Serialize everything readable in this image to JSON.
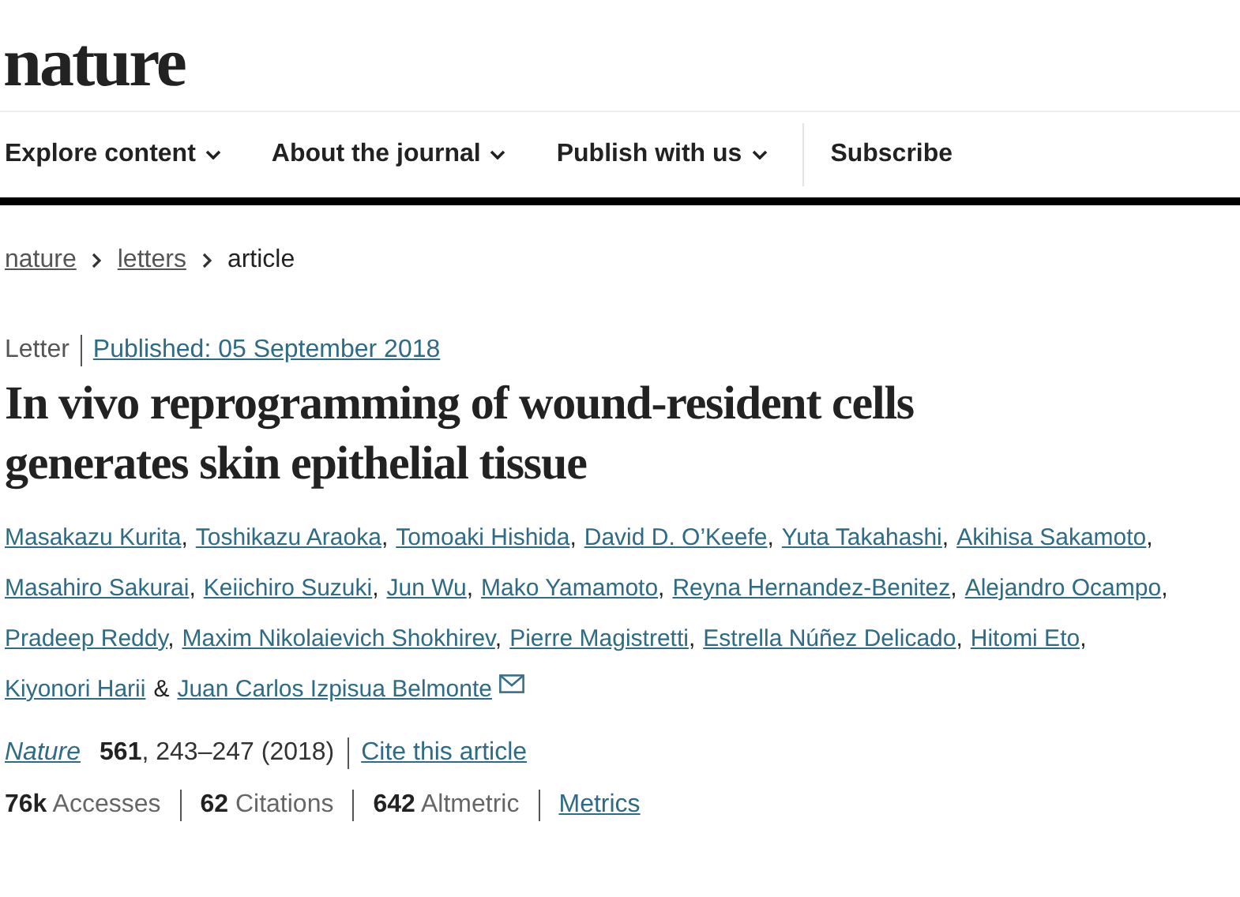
{
  "logo": "nature",
  "nav": [
    {
      "label": "Explore content",
      "kind": "menu"
    },
    {
      "label": "About the journal",
      "kind": "menu"
    },
    {
      "label": "Publish with us",
      "kind": "menu"
    },
    {
      "label": "Subscribe",
      "kind": "link"
    }
  ],
  "breadcrumbs": [
    {
      "label": "nature",
      "kind": "link"
    },
    {
      "label": "letters",
      "kind": "link"
    },
    {
      "label": "article",
      "kind": "current"
    }
  ],
  "article_type": "Letter",
  "published": "Published: 05 September 2018",
  "title": "In vivo reprogramming of wound-resident cells generates skin epithelial tissue",
  "authors": [
    {
      "name": "Masakazu Kurita",
      "separator": ",",
      "corresponding": false
    },
    {
      "name": "Toshikazu Araoka",
      "separator": ",",
      "corresponding": false
    },
    {
      "name": "Tomoaki Hishida",
      "separator": ",",
      "corresponding": false
    },
    {
      "name": "David D. O’Keefe",
      "separator": ",",
      "corresponding": false
    },
    {
      "name": "Yuta Takahashi",
      "separator": ",",
      "corresponding": false
    },
    {
      "name": "Akihisa Sakamoto",
      "separator": ",",
      "corresponding": false
    },
    {
      "name": "Masahiro Sakurai",
      "separator": ",",
      "corresponding": false
    },
    {
      "name": "Keiichiro Suzuki",
      "separator": ",",
      "corresponding": false
    },
    {
      "name": "Jun Wu",
      "separator": ",",
      "corresponding": false
    },
    {
      "name": "Mako Yamamoto",
      "separator": ",",
      "corresponding": false
    },
    {
      "name": "Reyna Hernandez-Benitez",
      "separator": ",",
      "corresponding": false
    },
    {
      "name": "Alejandro Ocampo",
      "separator": ",",
      "corresponding": false
    },
    {
      "name": "Pradeep Reddy",
      "separator": ",",
      "corresponding": false
    },
    {
      "name": "Maxim Nikolaievich Shokhirev",
      "separator": ",",
      "corresponding": false
    },
    {
      "name": "Pierre Magistretti",
      "separator": ",",
      "corresponding": false
    },
    {
      "name": "Estrella Núñez Delicado",
      "separator": ",",
      "corresponding": false
    },
    {
      "name": "Hitomi Eto",
      "separator": ",",
      "corresponding": false
    },
    {
      "name": "Kiyonori Harii",
      "separator": "&",
      "corresponding": false
    },
    {
      "name": "Juan Carlos Izpisua Belmonte",
      "corresponding": true
    }
  ],
  "citation": {
    "journal": "Nature",
    "volume": "561",
    "pages": ", 243–247 (2018)",
    "cite_link": "Cite this article"
  },
  "metrics": [
    "**76k** Accesses",
    "**62** Citations",
    "**642** Altmetric"
  ],
  "metrics_link": "Metrics"
}
